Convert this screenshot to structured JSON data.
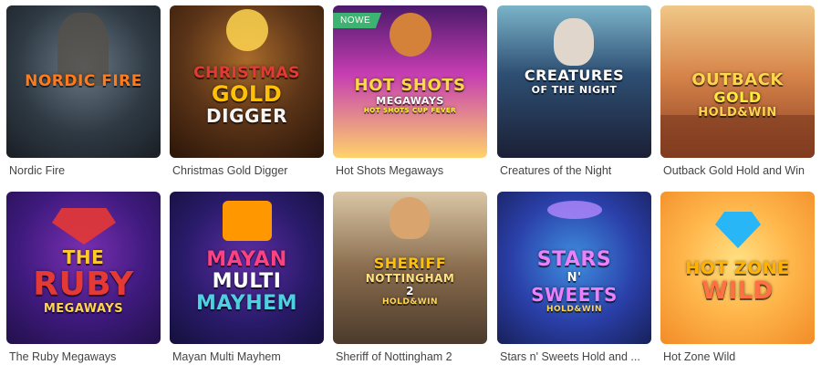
{
  "colors": {
    "caption_text": "#444444",
    "new_badge": "#3cb371"
  },
  "games": [
    {
      "title": "Nordic Fire",
      "art_lines": [
        "NORDIC FIRE"
      ],
      "art_colors": [
        "#ff7a1a"
      ],
      "badge": ""
    },
    {
      "title": "Christmas Gold Digger",
      "art_lines": [
        "CHRISTMAS",
        "GOLD",
        "DIGGER"
      ],
      "art_colors": [
        "#e53935",
        "#ffc107",
        "#f5f5f5"
      ],
      "badge": ""
    },
    {
      "title": "Hot Shots Megaways",
      "art_lines": [
        "HOT SHOTS",
        "MEGAWAYS",
        "HOT SHOTS CUP FEVER"
      ],
      "art_colors": [
        "#ffd740",
        "#ffffff",
        "#ffeb3b"
      ],
      "badge": "NOWE"
    },
    {
      "title": "Creatures of the Night",
      "art_lines": [
        "CREATURES",
        "OF THE NIGHT"
      ],
      "art_colors": [
        "#ffffff",
        "#ffffff"
      ],
      "badge": ""
    },
    {
      "title": "Outback Gold Hold and Win",
      "art_lines": [
        "OUTBACK",
        "GOLD",
        "HOLD&WIN"
      ],
      "art_colors": [
        "#ffd54f",
        "#ffeb3b",
        "#ffd54f"
      ],
      "badge": ""
    },
    {
      "title": "The Ruby Megaways",
      "art_lines": [
        "THE",
        "RUBY",
        "MEGAWAYS"
      ],
      "art_colors": [
        "#ffca28",
        "#e53935",
        "#ffd54f"
      ],
      "badge": ""
    },
    {
      "title": "Mayan Multi Mayhem",
      "art_lines": [
        "MAYAN",
        "MULTI",
        "MAYHEM"
      ],
      "art_colors": [
        "#ff4081",
        "#ffffff",
        "#4dd0e1"
      ],
      "badge": ""
    },
    {
      "title": "Sheriff of Nottingham 2",
      "art_lines": [
        "SHERIFF",
        "NOTTINGHAM",
        "2",
        "HOLD&WIN"
      ],
      "art_colors": [
        "#ffc107",
        "#ffe082",
        "#ffffff",
        "#ffd54f"
      ],
      "badge": ""
    },
    {
      "title": "Stars n' Sweets Hold and ...",
      "art_lines": [
        "STARS",
        "N'",
        "SWEETS",
        "HOLD&WIN"
      ],
      "art_colors": [
        "#ea80fc",
        "#ffffff",
        "#ea80fc",
        "#ffd54f"
      ],
      "badge": ""
    },
    {
      "title": "Hot Zone Wild",
      "art_lines": [
        "HOT ZONE",
        "WILD"
      ],
      "art_colors": [
        "#ffb300",
        "#ff7043"
      ],
      "badge": ""
    }
  ]
}
